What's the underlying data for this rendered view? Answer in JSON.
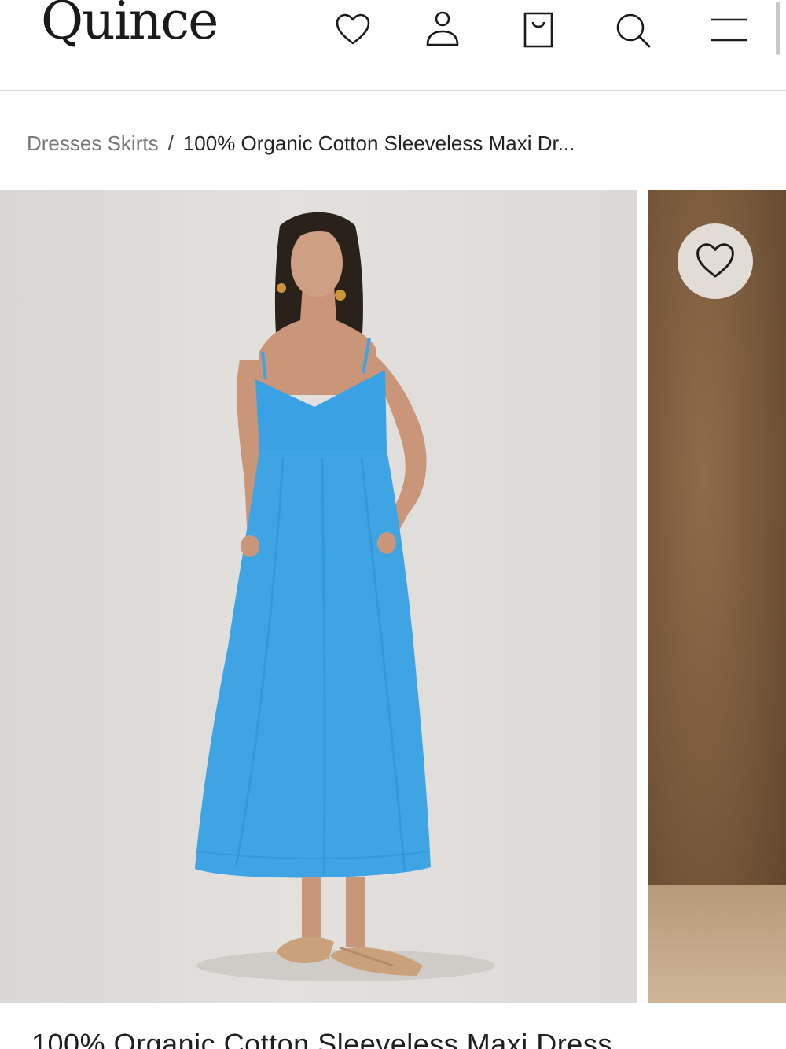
{
  "header": {
    "logo": "Quince",
    "icons": [
      "heart-icon",
      "user-icon",
      "bag-icon",
      "search-icon",
      "menu-icon"
    ]
  },
  "breadcrumb": {
    "category": "Dresses Skirts",
    "separator": "/",
    "current": "100% Organic Cotton Sleeveless Maxi Dr..."
  },
  "gallery": {
    "images": [
      {
        "alt": "Model wearing blue sleeveless maxi dress"
      },
      {
        "alt": "Next product image"
      }
    ],
    "wishlist_icon": "heart-icon"
  },
  "product": {
    "title": "100% Organic Cotton Sleeveless Maxi Dress"
  },
  "colors": {
    "dress": "#3ea4e4",
    "background": "#dcd9d6",
    "accent": "#1a1a1a"
  }
}
